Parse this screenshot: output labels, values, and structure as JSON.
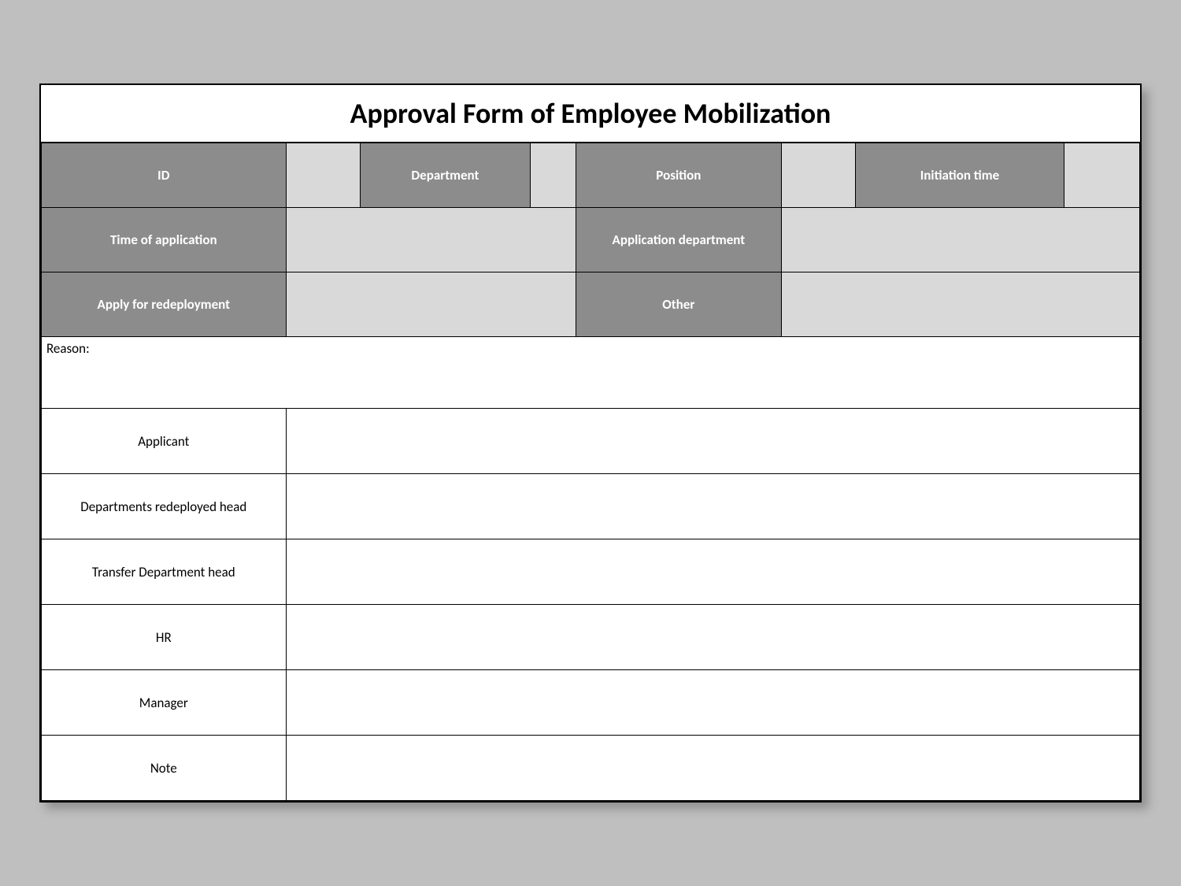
{
  "form": {
    "title": "Approval Form of Employee Mobilization",
    "row1": {
      "id_label": "ID",
      "id_value": "",
      "department_label": "Department",
      "department_value": "",
      "position_label": "Position",
      "position_value": "",
      "initiation_label": "Initiation time",
      "initiation_value": ""
    },
    "row2": {
      "time_label": "Time of application",
      "time_value": "",
      "app_dept_label": "Application department",
      "app_dept_value": ""
    },
    "row3": {
      "redeploy_label": "Apply for redeployment",
      "redeploy_value": "",
      "other_label": "Other",
      "other_value": ""
    },
    "reason_label": "Reason:",
    "signoffs": {
      "applicant": {
        "label": "Applicant",
        "value": ""
      },
      "redeployed_head": {
        "label": "Departments redeployed head",
        "value": ""
      },
      "transfer_head": {
        "label": "Transfer Department head",
        "value": ""
      },
      "hr": {
        "label": "HR",
        "value": ""
      },
      "manager": {
        "label": "Manager",
        "value": ""
      },
      "note": {
        "label": "Note",
        "value": ""
      }
    }
  },
  "colors": {
    "page_bg": "#bfbfbf",
    "header_dark": "#8c8c8c",
    "header_light": "#d9d9d9",
    "border": "#000000"
  }
}
